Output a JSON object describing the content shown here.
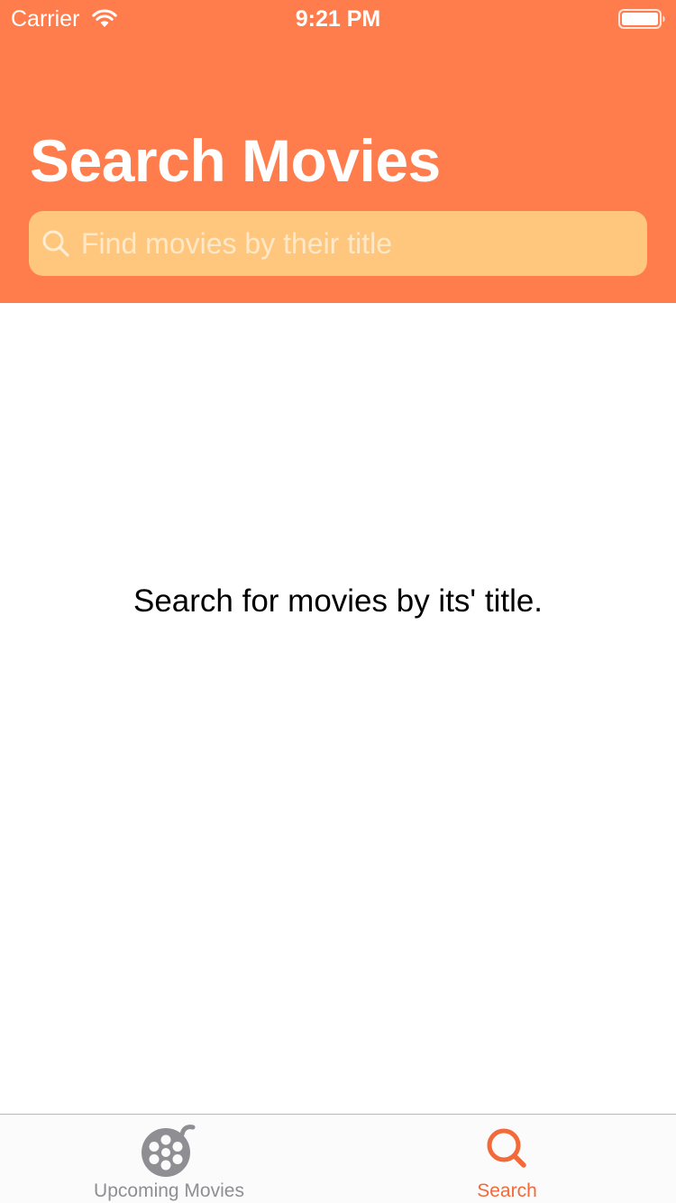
{
  "status_bar": {
    "carrier": "Carrier",
    "time": "9:21 PM"
  },
  "header": {
    "title": "Search Movies",
    "background_color": "#ff7d4c"
  },
  "search": {
    "placeholder": "Find movies by their title",
    "value": "",
    "field_color": "#ffc77d",
    "icon": "search-icon"
  },
  "main": {
    "empty_message": "Search for movies by its' title."
  },
  "tab_bar": {
    "tabs": [
      {
        "label": "Upcoming Movies",
        "icon": "film-reel-icon",
        "selected": false
      },
      {
        "label": "Search",
        "icon": "search-icon",
        "selected": true
      }
    ],
    "active_color": "#f26a3a",
    "inactive_color": "#8e8e93"
  }
}
